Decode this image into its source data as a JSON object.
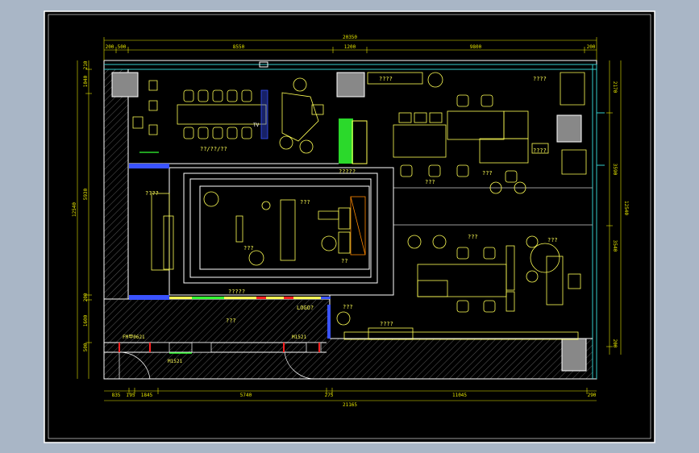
{
  "colors": {
    "outer_bg": "#a9b6c6",
    "sheet": "#000000",
    "wall": "#ffffff",
    "dimension": "#e6e600",
    "glass": "#33cccc",
    "furniture": "#ffff55",
    "accent_blue": "#3a53ff",
    "accent_red": "#ff2020",
    "accent_green": "#33ff33",
    "gray": "#9a9a9a"
  },
  "dimensions": {
    "top_overall": "20350",
    "top_segments": [
      "200",
      "500",
      "8550",
      "1200",
      "9800",
      "200"
    ],
    "bottom_overall": "21165",
    "bottom_segments": [
      "835",
      "1",
      "95",
      "1845",
      "5740",
      "275",
      "11045",
      "290"
    ],
    "left_overall": "12540",
    "left_segments": [
      "210",
      "1040",
      "5930",
      "200",
      "1600",
      "500"
    ],
    "right_overall": "12540",
    "right_segments": [
      "2170",
      "3590",
      "3540",
      "200"
    ]
  },
  "labels": {
    "meeting_room": "??/??/??",
    "tv": "TV",
    "mgr_top": "????",
    "mgr_top_right": "????",
    "open_office_label": "????",
    "staff_a": "???",
    "staff_b": "???",
    "center_top": "?????",
    "left_room": "????",
    "center_desk": "???",
    "center_chair": "???",
    "center_round": "??",
    "center_bottom": "?????",
    "office_b": "???",
    "boss": "???",
    "logo": "LOGO?",
    "reception": "???",
    "corridor": "???",
    "cabinet": "????",
    "fire_left": "FM甲0621",
    "fire_right": "M1521",
    "entrance": "M1521"
  }
}
